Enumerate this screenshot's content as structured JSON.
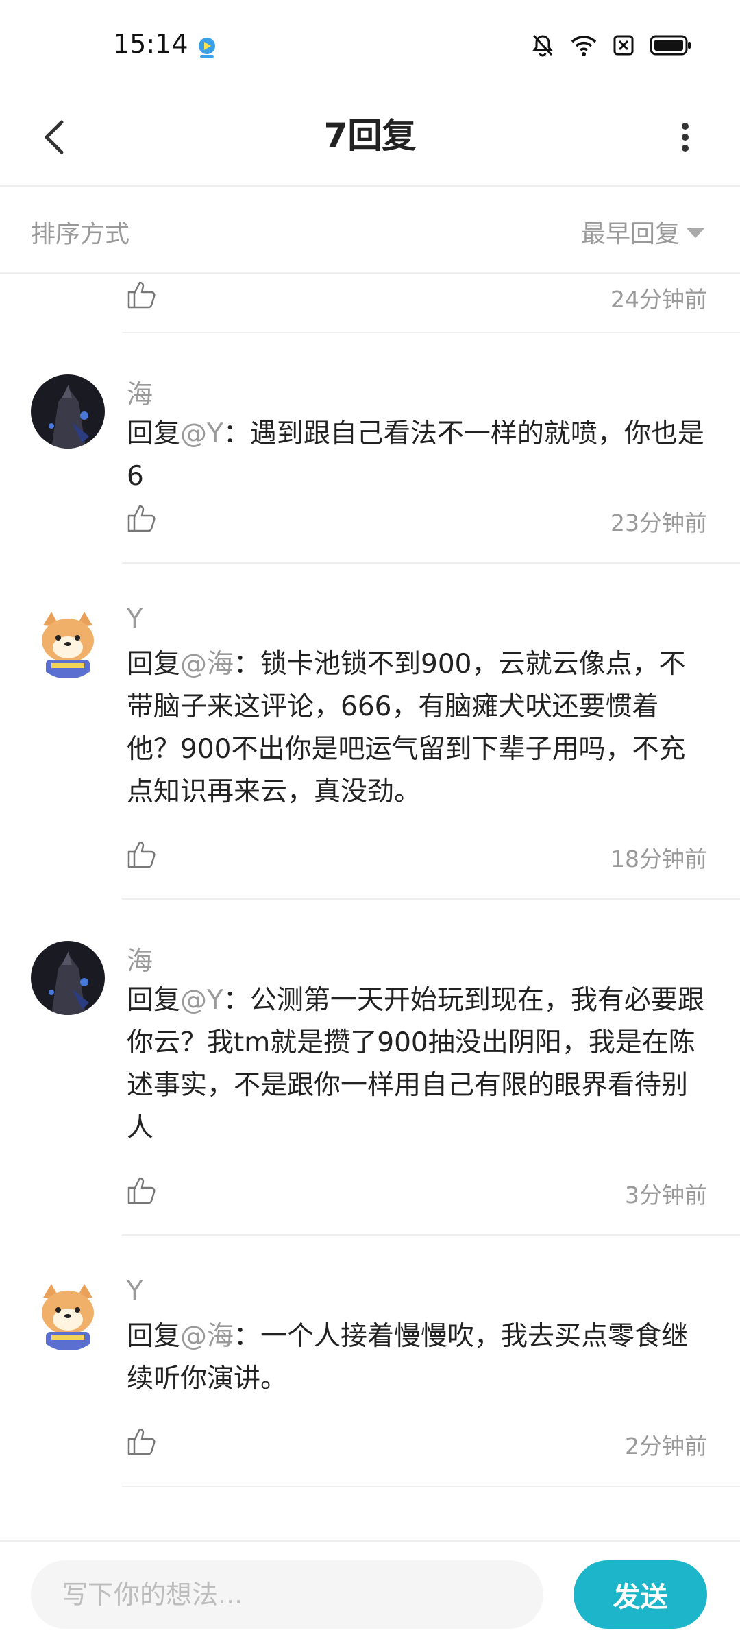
{
  "statusbar": {
    "time": "15:14",
    "icons": [
      "app-badge-icon",
      "mute-icon",
      "wifi-icon",
      "sim-icon",
      "battery-icon"
    ]
  },
  "header": {
    "title": "7回复",
    "back_icon": "chevron-left-icon",
    "more_icon": "vertical-dots-icon"
  },
  "sort": {
    "label": "排序方式",
    "selected": "最早回复"
  },
  "comments": [
    {
      "time_ago": "24分钟前"
    },
    {
      "username": "海",
      "reply_prefix": "回复",
      "reply_to": "@Y",
      "text": "：遇到跟自己看法不一样的就喷，你也是6",
      "time_ago": "23分钟前"
    },
    {
      "username": "Y",
      "reply_prefix": "回复",
      "reply_to": "@海",
      "text": "：锁卡池锁不到900，云就云像点，不带脑子来这评论，666，有脑瘫犬吠还要惯着他？900不出你是吧运气留到下辈子用吗，不充点知识再来云，真没劲。",
      "time_ago": "18分钟前"
    },
    {
      "username": "海",
      "reply_prefix": "回复",
      "reply_to": "@Y",
      "text": "：公测第一天开始玩到现在，我有必要跟你云？我tm就是攒了900抽没出阴阳，我是在陈述事实，不是跟你一样用自己有限的眼界看待别人",
      "time_ago": "3分钟前"
    },
    {
      "username": "Y",
      "reply_prefix": "回复",
      "reply_to": "@海",
      "text": "：一个人接着慢慢吹，我去买点零食继续听你演讲。",
      "time_ago": "2分钟前"
    }
  ],
  "composer": {
    "placeholder": "写下你的想法...",
    "value": "",
    "send_label": "发送"
  },
  "colors": {
    "accent": "#1cb5c9",
    "muted_text": "#9a9a9a",
    "body_text": "#222222"
  }
}
